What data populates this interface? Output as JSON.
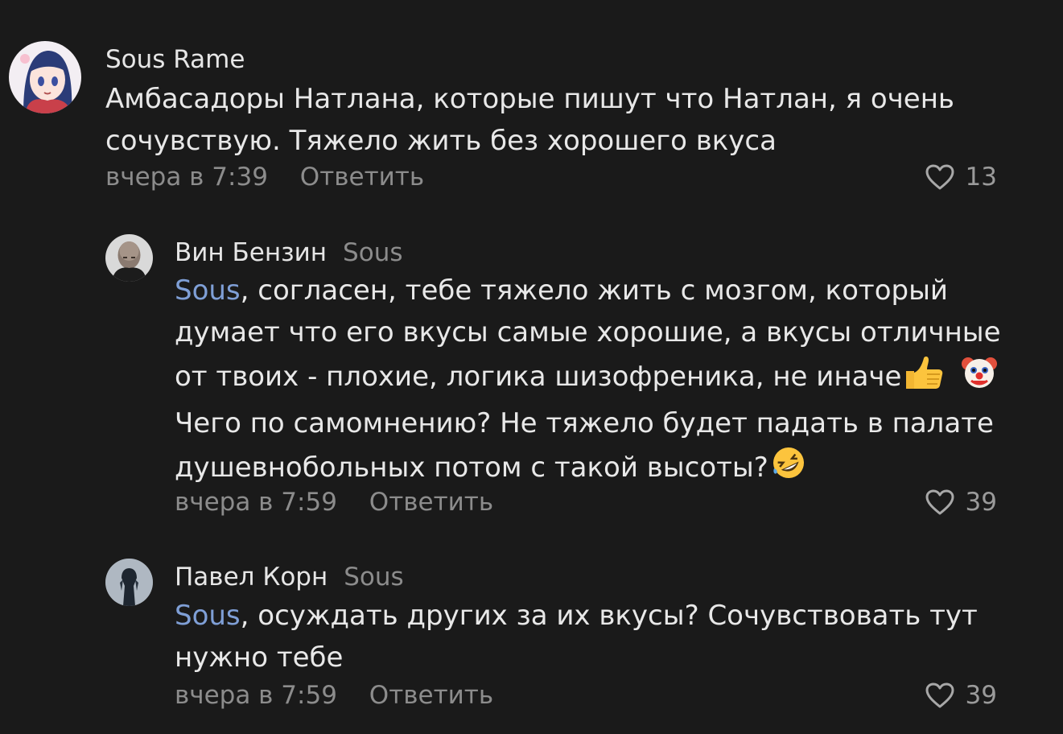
{
  "comments": [
    {
      "author": "Sous Rame",
      "reply_to": "",
      "mention": "",
      "lines": [
        "Амбасадоры Натлана, которые пишут что Натлан, я очень",
        "сочувствую. Тяжело жить без хорошего вкуса"
      ],
      "time": "вчера в 7:39",
      "reply_label": "Ответить",
      "likes": "13",
      "avatar_icon": "anime-girl-avatar"
    },
    {
      "author": "Вин Бензин",
      "reply_to": "Sous",
      "mention": "Sous",
      "lines": [
        ", согласен, тебе тяжело жить с мозгом, который",
        "думает что его вкусы самые хорошие, а вкусы отличные",
        "от твоих - плохие, логика шизофреника, не иначе",
        "Чего по самомнению? Не тяжело будет падать в палате",
        "душевнобольных потом с такой высоты?"
      ],
      "time": "вчера в 7:59",
      "reply_label": "Ответить",
      "likes": "39",
      "avatar_icon": "bald-man-avatar",
      "emojis": [
        "thumbs-up-emoji",
        "clown-face-emoji",
        "rolling-laughing-emoji"
      ]
    },
    {
      "author": "Павел Корн",
      "reply_to": "Sous",
      "mention": "Sous",
      "lines": [
        ", осуждать других за их вкусы? Сочувствовать тут",
        "нужно тебе"
      ],
      "time": "вчера в 7:59",
      "reply_label": "Ответить",
      "likes": "39",
      "avatar_icon": "dark-figure-avatar"
    }
  ],
  "colors": {
    "background": "#1a1a1a",
    "text": "#e8e8e8",
    "muted": "#8c8c8c",
    "mention": "#7f9fd6"
  },
  "icons": {
    "like": "heart-outline-icon"
  }
}
